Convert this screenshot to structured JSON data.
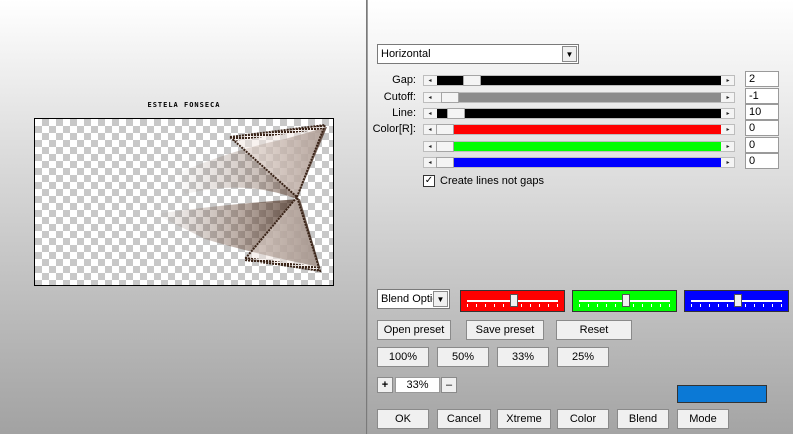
{
  "preview": {
    "caption": "ESTELA FONSECA"
  },
  "direction": {
    "value": "Horizontal"
  },
  "controls": [
    {
      "label": "Gap:",
      "value": "2",
      "fill_color": "#000000",
      "level": 0.1
    },
    {
      "label": "Cutoff:",
      "value": "-1",
      "fill_color": "#8c8c8c",
      "level": 0.02
    },
    {
      "label": "Line:",
      "value": "10",
      "fill_color": "#000000",
      "level": 0.04
    },
    {
      "label": "Color[R]:",
      "value": "0",
      "fill_color": "#ff0000",
      "level": 0.0
    },
    {
      "label": "",
      "value": "0",
      "fill_color": "#00ff00",
      "level": 0.0
    },
    {
      "label": "",
      "value": "0",
      "fill_color": "#0000ff",
      "level": 0.0
    }
  ],
  "checkbox": {
    "label": "Create lines not gaps",
    "checked": "✓"
  },
  "blend_select": {
    "value": "Blend Optio"
  },
  "color_sliders": [
    {
      "color": "#ff0000",
      "level": 0.5
    },
    {
      "color": "#00ff00",
      "level": 0.5
    },
    {
      "color": "#0000ff",
      "level": 0.5
    }
  ],
  "preset_buttons": {
    "open": "Open preset",
    "save": "Save preset",
    "reset": "Reset"
  },
  "zoom_buttons": [
    "100%",
    "50%",
    "33%",
    "25%"
  ],
  "zoom": {
    "plus": "+",
    "value": "33%",
    "minus": "–"
  },
  "swatch_color": "#0b79d6",
  "bottom_buttons": [
    "OK",
    "Cancel",
    "Xtreme",
    "Color",
    "Blend",
    "Mode"
  ]
}
